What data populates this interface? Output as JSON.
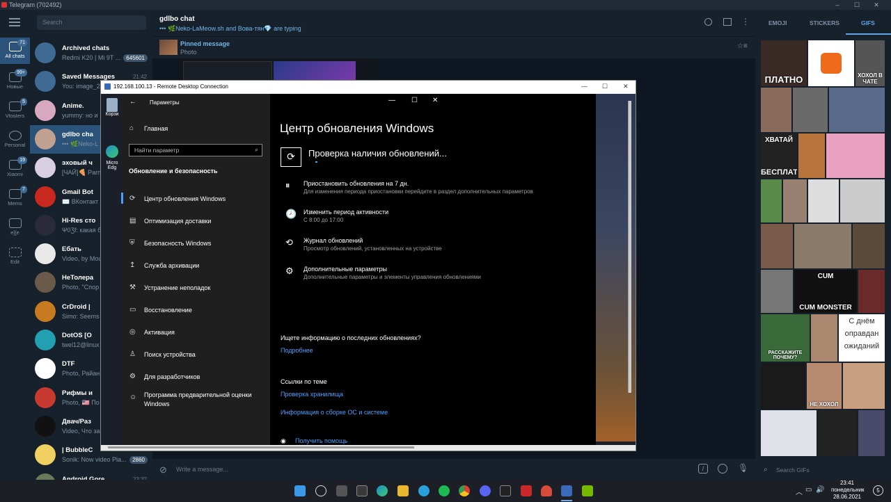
{
  "window": {
    "title": "Telegram (702492)"
  },
  "rail": [
    {
      "label": "All chats",
      "badge": "71"
    },
    {
      "label": "Новые",
      "badge": "99+"
    },
    {
      "label": "Vtosters",
      "badge": "5"
    },
    {
      "label": "Personal",
      "badge": ""
    },
    {
      "label": "Xiaomi",
      "badge": "19"
    },
    {
      "label": "Mems",
      "badge": "7"
    },
    {
      "label": "e][e",
      "badge": ""
    },
    {
      "label": "Edit",
      "badge": ""
    }
  ],
  "search": {
    "placeholder": "Search"
  },
  "chats": [
    {
      "name": "Archived chats",
      "preview": "Redmi K20 | Mi 9T ...",
      "time": "",
      "badge": "645601"
    },
    {
      "name": "Saved Messages",
      "preview": "You: image_2",
      "time": "21:42",
      "badge": ""
    },
    {
      "name": "Anime.",
      "preview": "yummy: но и",
      "time": "",
      "badge": ""
    },
    {
      "name": "gdlbo cha",
      "preview": "••• 🌿Neko-L",
      "time": "",
      "badge": ""
    },
    {
      "name": "эховый ч",
      "preview": "[ЧАЙ]🍕 Parn",
      "time": "",
      "badge": ""
    },
    {
      "name": "Gmail Bot",
      "preview": "✉️ ВКонтакт",
      "time": "",
      "badge": ""
    },
    {
      "name": "Hi-Res сто",
      "preview": "Ψ0Ʒf: какая б",
      "time": "",
      "badge": ""
    },
    {
      "name": "Ебать",
      "preview": "Video, by Mou",
      "time": "",
      "badge": ""
    },
    {
      "name": "НеТолера",
      "preview": "Photo, \"Спор",
      "time": "",
      "badge": ""
    },
    {
      "name": "CrDroid |",
      "preview": "Simo: Seems g",
      "time": "",
      "badge": ""
    },
    {
      "name": "DotOS [O",
      "preview": "twel12@linux",
      "time": "",
      "badge": ""
    },
    {
      "name": "DTF",
      "preview": "Photo, Райан",
      "time": "",
      "badge": ""
    },
    {
      "name": "Рифмы и",
      "preview": "Photo, 🇺🇸 По",
      "time": "",
      "badge": ""
    },
    {
      "name": "Двач/Раз",
      "preview": "Video, Что за",
      "time": "",
      "badge": ""
    },
    {
      "name": "| BubbleC",
      "preview": "Sonik: Now video Pla...",
      "time": "",
      "badge": "2860"
    },
    {
      "name": "Android Gore",
      "preview": "",
      "time": "23:32",
      "badge": ""
    }
  ],
  "chat": {
    "title": "gdlbo chat",
    "status_names": "••• 🌿Neko-LaMeow.sh and Вова-тян💎",
    "status_typing": "are typing",
    "pinned_label": "Pinned message",
    "pinned_text": "Photo",
    "composer_placeholder": "Write a message..."
  },
  "gifs": {
    "tabs": [
      "EMOJI",
      "STICKERS",
      "GIFS"
    ],
    "search_placeholder": "Search GIFs",
    "captions": [
      "ПЛАТНО",
      "ХОХОЛ В ЧАТЕ",
      "ХВАТАЙ",
      "БЕСПЛАТНО",
      "CUM",
      "CUM MONSTER",
      "С днём",
      "оправдан",
      "ожиданий",
      "РАССКАЖИТЕ ПОЧЕМУ?",
      "НЕ ХОХОЛ"
    ]
  },
  "rdp": {
    "title": "192.168.100.13 - Remote Desktop Connection",
    "desktop_icons": [
      "Корзи",
      "Micro",
      "Edg"
    ]
  },
  "settings": {
    "app_title": "Параметры",
    "home": "Главная",
    "search_placeholder": "Найти параметр",
    "section": "Обновление и безопасность",
    "nav": [
      "Центр обновления Windows",
      "Оптимизация доставки",
      "Безопасность Windows",
      "Служба архивации",
      "Устранение неполадок",
      "Восстановление",
      "Активация",
      "Поиск устройства",
      "Для разработчиков",
      "Программа предварительной оценки Windows"
    ],
    "page_title": "Центр обновления Windows",
    "checking": "Проверка наличия обновлений...",
    "options": [
      {
        "title": "Приостановить обновления на 7 дн.",
        "sub": "Для изменения периода приостановки перейдите в раздел дополнительных параметров",
        "icon": "⏸"
      },
      {
        "title": "Изменить период активности",
        "sub": "С 8:00 до 17:00",
        "icon": "🕗"
      },
      {
        "title": "Журнал обновлений",
        "sub": "Просмотр обновлений, установленных на устройстве",
        "icon": "⟲"
      },
      {
        "title": "Дополнительные параметры",
        "sub": "Дополнительные параметры и элементы управления обновлениями",
        "icon": "⚙"
      }
    ],
    "info_q": "Ищете информацию о последних обновлениях?",
    "info_link": "Подробнее",
    "related_title": "Ссылки по теме",
    "related_links": [
      "Проверка хранилища",
      "Информация о сборке ОС и системе"
    ],
    "help": "Получить помощь"
  },
  "taskbar": {
    "time": "23:41",
    "day": "понедельник",
    "date": "28.06.2021",
    "notif": "5"
  }
}
